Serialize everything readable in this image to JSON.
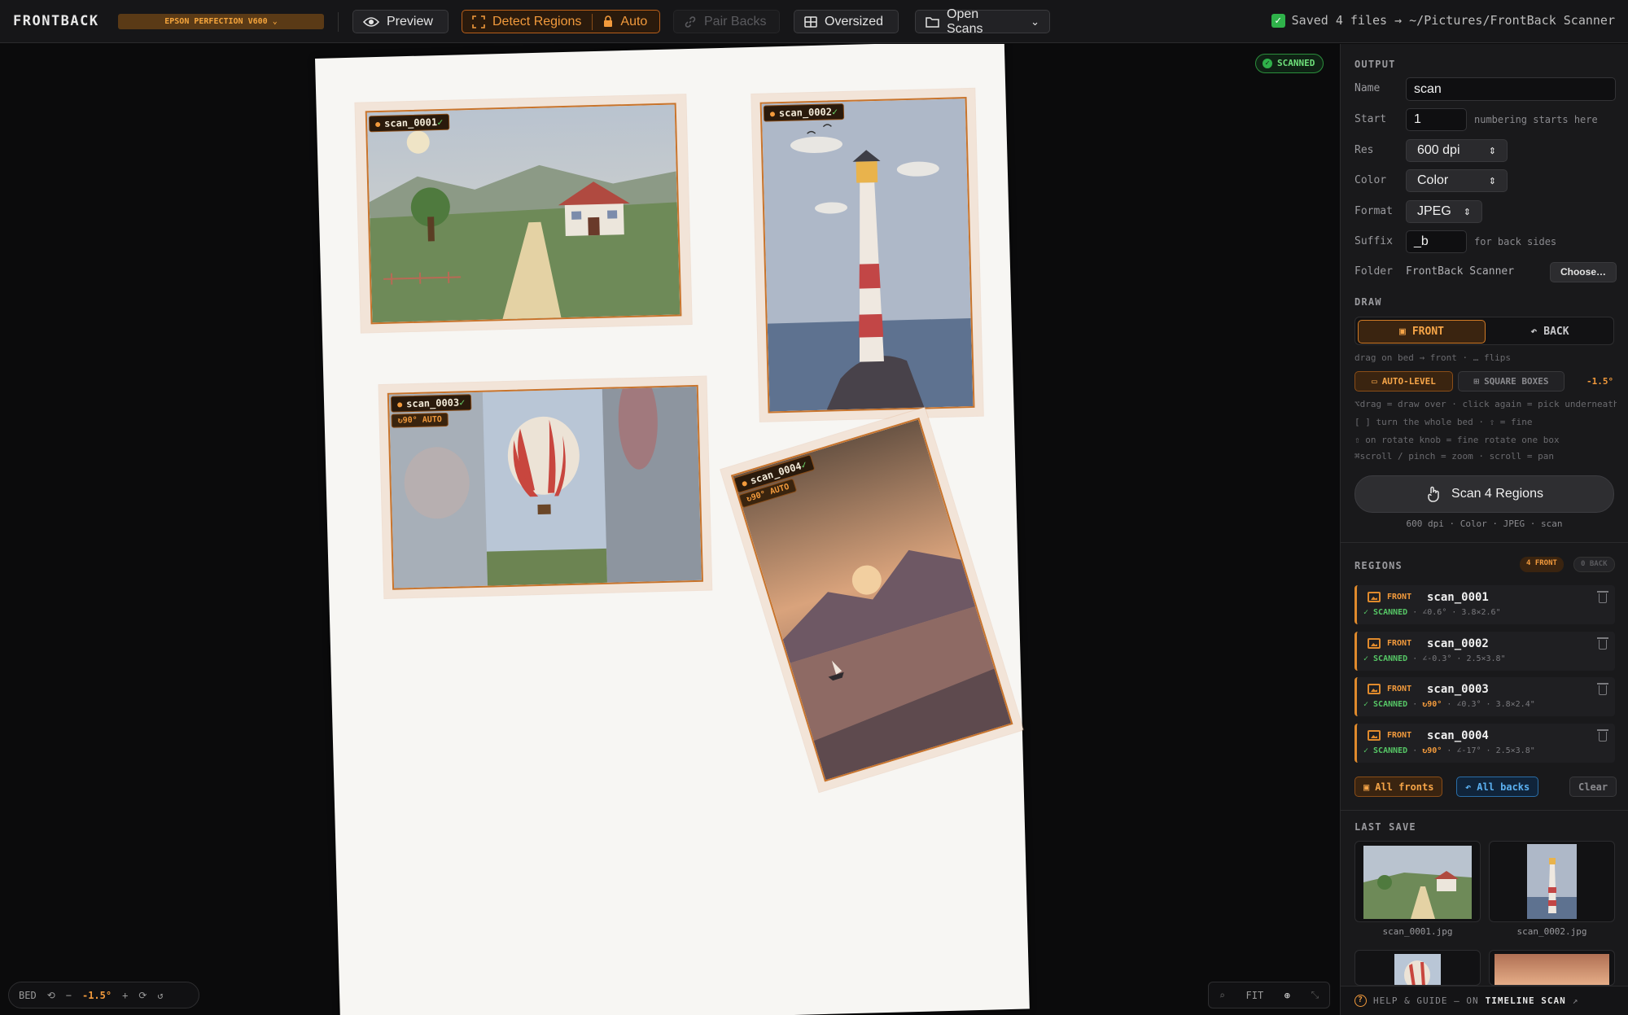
{
  "topbar": {
    "brand": "FRONTBACK",
    "device": "EPSON PERFECTION V600",
    "preview_label": "Preview",
    "detect_label": "Detect Regions",
    "auto_label": "Auto",
    "pair_label": "Pair Backs",
    "oversized_label": "Oversized",
    "open_label": "Open Scans",
    "saved_message": "Saved 4 files → ~/Pictures/FrontBack Scanner"
  },
  "canvas": {
    "status_badge": "SCANNED",
    "bed_label": "BED",
    "bed_angle": "-1.5°",
    "zoom_fit": "FIT",
    "regions": [
      {
        "name": "scan_0001",
        "check": "✓"
      },
      {
        "name": "scan_0002",
        "check": "✓"
      },
      {
        "name": "scan_0003",
        "check": "✓",
        "auto": "↻90° AUTO"
      },
      {
        "name": "scan_0004",
        "check": "✓",
        "auto": "↻90° AUTO"
      }
    ]
  },
  "output": {
    "section": "OUTPUT",
    "name_label": "Name",
    "name_value": "scan",
    "start_label": "Start",
    "start_value": "1",
    "start_hint": "numbering starts here",
    "res_label": "Res",
    "res_value": "600 dpi",
    "color_label": "Color",
    "color_value": "Color",
    "format_label": "Format",
    "format_value": "JPEG",
    "suffix_label": "Suffix",
    "suffix_value": "_b",
    "suffix_hint": "for back sides",
    "folder_label": "Folder",
    "folder_value": "FrontBack Scanner",
    "choose_label": "Choose…"
  },
  "draw": {
    "section": "DRAW",
    "front_label": "FRONT",
    "back_label": "BACK",
    "hint1": "drag on bed → front · … flips",
    "auto_level_label": "AUTO-LEVEL",
    "square_label": "SQUARE BOXES",
    "angle": "-1.5°",
    "hint2": "⌥drag = draw over · click again = pick underneath",
    "hint3": "[ ] turn the whole bed · ⇧ = fine",
    "hint4": "⇧ on rotate knob = fine rotate one box",
    "hint5": "⌘scroll / pinch = zoom · scroll = pan",
    "scan_label": "Scan 4 Regions",
    "scan_sub": "600 dpi · Color · JPEG · scan"
  },
  "regions": {
    "section": "REGIONS",
    "front_count": "4 FRONT",
    "back_count": "0 BACK",
    "items": [
      {
        "side": "FRONT",
        "name": "scan_0001",
        "status": "✓ SCANNED",
        "rot": "",
        "angle": "∠0.6°",
        "size": "3.8×2.6\""
      },
      {
        "side": "FRONT",
        "name": "scan_0002",
        "status": "✓ SCANNED",
        "rot": "",
        "angle": "∠-0.3°",
        "size": "2.5×3.8\""
      },
      {
        "side": "FRONT",
        "name": "scan_0003",
        "status": "✓ SCANNED",
        "rot": "↻90°",
        "angle": "∠0.3°",
        "size": "3.8×2.4\""
      },
      {
        "side": "FRONT",
        "name": "scan_0004",
        "status": "✓ SCANNED",
        "rot": "↻90°",
        "angle": "∠-17°",
        "size": "2.5×3.8\""
      }
    ],
    "all_fronts": "All fronts",
    "all_backs": "All backs",
    "clear": "Clear"
  },
  "last_save": {
    "section": "LAST SAVE",
    "files": [
      "scan_0001.jpg",
      "scan_0002.jpg"
    ]
  },
  "help": {
    "text": "HELP & GUIDE — ON",
    "brand": "TIMELINE SCAN",
    "arrow": "↗"
  },
  "colors": {
    "accent": "#f29a3c",
    "success": "#2fb24a",
    "back_accent": "#3a9be0"
  }
}
